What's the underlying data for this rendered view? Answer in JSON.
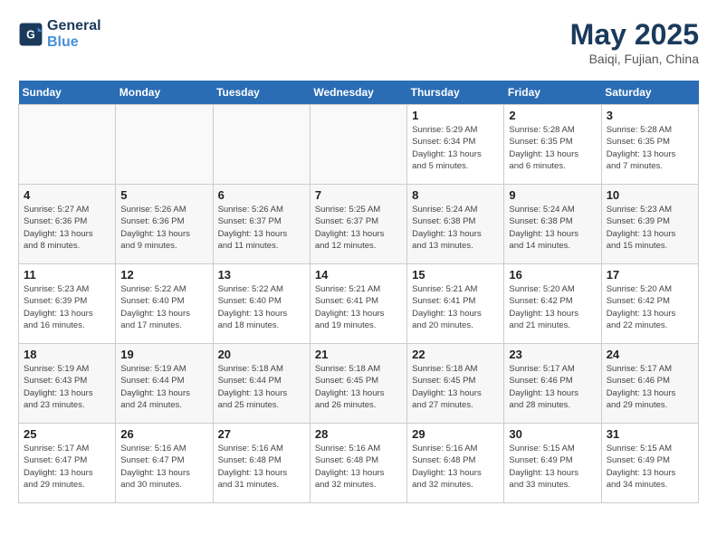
{
  "header": {
    "logo_line1": "General",
    "logo_line2": "Blue",
    "title": "May 2025",
    "location": "Baiqi, Fujian, China"
  },
  "weekdays": [
    "Sunday",
    "Monday",
    "Tuesday",
    "Wednesday",
    "Thursday",
    "Friday",
    "Saturday"
  ],
  "weeks": [
    [
      {
        "day": "",
        "info": "",
        "empty": true
      },
      {
        "day": "",
        "info": "",
        "empty": true
      },
      {
        "day": "",
        "info": "",
        "empty": true
      },
      {
        "day": "",
        "info": "",
        "empty": true
      },
      {
        "day": "1",
        "info": "Sunrise: 5:29 AM\nSunset: 6:34 PM\nDaylight: 13 hours\nand 5 minutes.",
        "empty": false
      },
      {
        "day": "2",
        "info": "Sunrise: 5:28 AM\nSunset: 6:35 PM\nDaylight: 13 hours\nand 6 minutes.",
        "empty": false
      },
      {
        "day": "3",
        "info": "Sunrise: 5:28 AM\nSunset: 6:35 PM\nDaylight: 13 hours\nand 7 minutes.",
        "empty": false
      }
    ],
    [
      {
        "day": "4",
        "info": "Sunrise: 5:27 AM\nSunset: 6:36 PM\nDaylight: 13 hours\nand 8 minutes.",
        "empty": false
      },
      {
        "day": "5",
        "info": "Sunrise: 5:26 AM\nSunset: 6:36 PM\nDaylight: 13 hours\nand 9 minutes.",
        "empty": false
      },
      {
        "day": "6",
        "info": "Sunrise: 5:26 AM\nSunset: 6:37 PM\nDaylight: 13 hours\nand 11 minutes.",
        "empty": false
      },
      {
        "day": "7",
        "info": "Sunrise: 5:25 AM\nSunset: 6:37 PM\nDaylight: 13 hours\nand 12 minutes.",
        "empty": false
      },
      {
        "day": "8",
        "info": "Sunrise: 5:24 AM\nSunset: 6:38 PM\nDaylight: 13 hours\nand 13 minutes.",
        "empty": false
      },
      {
        "day": "9",
        "info": "Sunrise: 5:24 AM\nSunset: 6:38 PM\nDaylight: 13 hours\nand 14 minutes.",
        "empty": false
      },
      {
        "day": "10",
        "info": "Sunrise: 5:23 AM\nSunset: 6:39 PM\nDaylight: 13 hours\nand 15 minutes.",
        "empty": false
      }
    ],
    [
      {
        "day": "11",
        "info": "Sunrise: 5:23 AM\nSunset: 6:39 PM\nDaylight: 13 hours\nand 16 minutes.",
        "empty": false
      },
      {
        "day": "12",
        "info": "Sunrise: 5:22 AM\nSunset: 6:40 PM\nDaylight: 13 hours\nand 17 minutes.",
        "empty": false
      },
      {
        "day": "13",
        "info": "Sunrise: 5:22 AM\nSunset: 6:40 PM\nDaylight: 13 hours\nand 18 minutes.",
        "empty": false
      },
      {
        "day": "14",
        "info": "Sunrise: 5:21 AM\nSunset: 6:41 PM\nDaylight: 13 hours\nand 19 minutes.",
        "empty": false
      },
      {
        "day": "15",
        "info": "Sunrise: 5:21 AM\nSunset: 6:41 PM\nDaylight: 13 hours\nand 20 minutes.",
        "empty": false
      },
      {
        "day": "16",
        "info": "Sunrise: 5:20 AM\nSunset: 6:42 PM\nDaylight: 13 hours\nand 21 minutes.",
        "empty": false
      },
      {
        "day": "17",
        "info": "Sunrise: 5:20 AM\nSunset: 6:42 PM\nDaylight: 13 hours\nand 22 minutes.",
        "empty": false
      }
    ],
    [
      {
        "day": "18",
        "info": "Sunrise: 5:19 AM\nSunset: 6:43 PM\nDaylight: 13 hours\nand 23 minutes.",
        "empty": false
      },
      {
        "day": "19",
        "info": "Sunrise: 5:19 AM\nSunset: 6:44 PM\nDaylight: 13 hours\nand 24 minutes.",
        "empty": false
      },
      {
        "day": "20",
        "info": "Sunrise: 5:18 AM\nSunset: 6:44 PM\nDaylight: 13 hours\nand 25 minutes.",
        "empty": false
      },
      {
        "day": "21",
        "info": "Sunrise: 5:18 AM\nSunset: 6:45 PM\nDaylight: 13 hours\nand 26 minutes.",
        "empty": false
      },
      {
        "day": "22",
        "info": "Sunrise: 5:18 AM\nSunset: 6:45 PM\nDaylight: 13 hours\nand 27 minutes.",
        "empty": false
      },
      {
        "day": "23",
        "info": "Sunrise: 5:17 AM\nSunset: 6:46 PM\nDaylight: 13 hours\nand 28 minutes.",
        "empty": false
      },
      {
        "day": "24",
        "info": "Sunrise: 5:17 AM\nSunset: 6:46 PM\nDaylight: 13 hours\nand 29 minutes.",
        "empty": false
      }
    ],
    [
      {
        "day": "25",
        "info": "Sunrise: 5:17 AM\nSunset: 6:47 PM\nDaylight: 13 hours\nand 29 minutes.",
        "empty": false
      },
      {
        "day": "26",
        "info": "Sunrise: 5:16 AM\nSunset: 6:47 PM\nDaylight: 13 hours\nand 30 minutes.",
        "empty": false
      },
      {
        "day": "27",
        "info": "Sunrise: 5:16 AM\nSunset: 6:48 PM\nDaylight: 13 hours\nand 31 minutes.",
        "empty": false
      },
      {
        "day": "28",
        "info": "Sunrise: 5:16 AM\nSunset: 6:48 PM\nDaylight: 13 hours\nand 32 minutes.",
        "empty": false
      },
      {
        "day": "29",
        "info": "Sunrise: 5:16 AM\nSunset: 6:48 PM\nDaylight: 13 hours\nand 32 minutes.",
        "empty": false
      },
      {
        "day": "30",
        "info": "Sunrise: 5:15 AM\nSunset: 6:49 PM\nDaylight: 13 hours\nand 33 minutes.",
        "empty": false
      },
      {
        "day": "31",
        "info": "Sunrise: 5:15 AM\nSunset: 6:49 PM\nDaylight: 13 hours\nand 34 minutes.",
        "empty": false
      }
    ]
  ]
}
